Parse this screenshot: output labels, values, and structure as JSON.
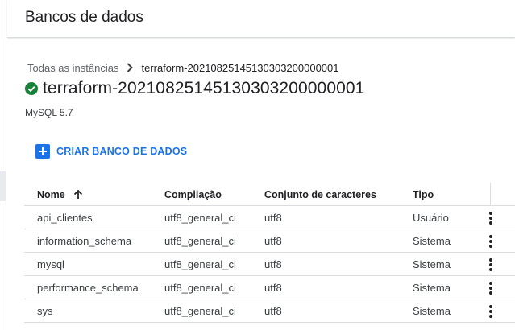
{
  "header": {
    "title": "Bancos de dados"
  },
  "breadcrumb": {
    "parent": "Todas as instâncias",
    "current": "terraform-20210825145130303200000001"
  },
  "instance": {
    "name": "terraform-20210825145130303200000001",
    "status_icon": "check-circle-icon",
    "status_color": "#188038",
    "version": "MySQL 5.7"
  },
  "actions": {
    "create_label": "CRIAR BANCO DE DADOS",
    "accent": "#1a73e8"
  },
  "table": {
    "columns": {
      "name": "Nome",
      "collation": "Compilação",
      "charset": "Conjunto de caracteres",
      "type": "Tipo"
    },
    "rows": [
      {
        "name": "api_clientes",
        "collation": "utf8_general_ci",
        "charset": "utf8",
        "type": "Usuário"
      },
      {
        "name": "information_schema",
        "collation": "utf8_general_ci",
        "charset": "utf8",
        "type": "Sistema"
      },
      {
        "name": "mysql",
        "collation": "utf8_general_ci",
        "charset": "utf8",
        "type": "Sistema"
      },
      {
        "name": "performance_schema",
        "collation": "utf8_general_ci",
        "charset": "utf8",
        "type": "Sistema"
      },
      {
        "name": "sys",
        "collation": "utf8_general_ci",
        "charset": "utf8",
        "type": "Sistema"
      }
    ]
  }
}
